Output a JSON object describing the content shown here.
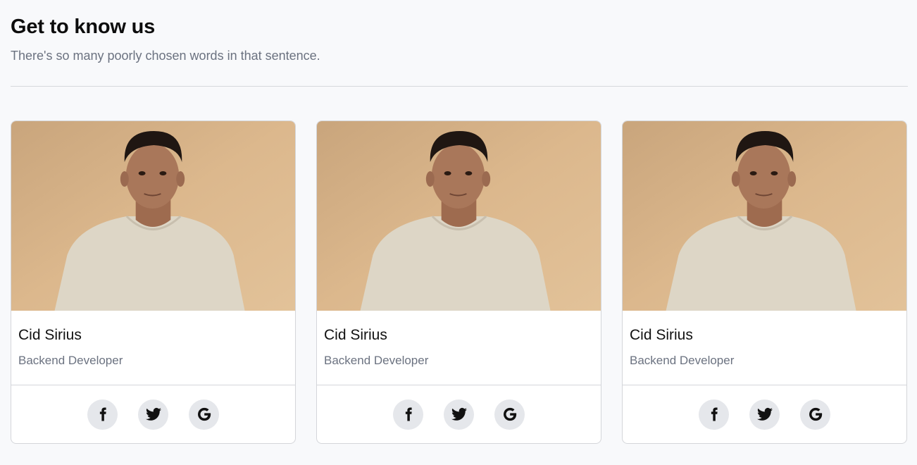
{
  "header": {
    "title": "Get to know us",
    "subtitle": "There's so many poorly chosen words in that sentence."
  },
  "cards": [
    {
      "name": "Cid Sirius",
      "role": "Backend Developer",
      "photo_icon": "person-portrait-photo",
      "social": [
        "facebook-icon",
        "twitter-icon",
        "google-icon"
      ]
    },
    {
      "name": "Cid Sirius",
      "role": "Backend Developer",
      "photo_icon": "person-portrait-photo",
      "social": [
        "facebook-icon",
        "twitter-icon",
        "google-icon"
      ]
    },
    {
      "name": "Cid Sirius",
      "role": "Backend Developer",
      "photo_icon": "person-portrait-photo",
      "social": [
        "facebook-icon",
        "twitter-icon",
        "google-icon"
      ]
    }
  ],
  "colors": {
    "background": "#f8f9fb",
    "photo_backdrop": "#d9b587",
    "shirt": "#ddd6c6",
    "skin": "#a9775a",
    "hair": "#1f1612",
    "social_button_bg": "#e5e7eb"
  }
}
